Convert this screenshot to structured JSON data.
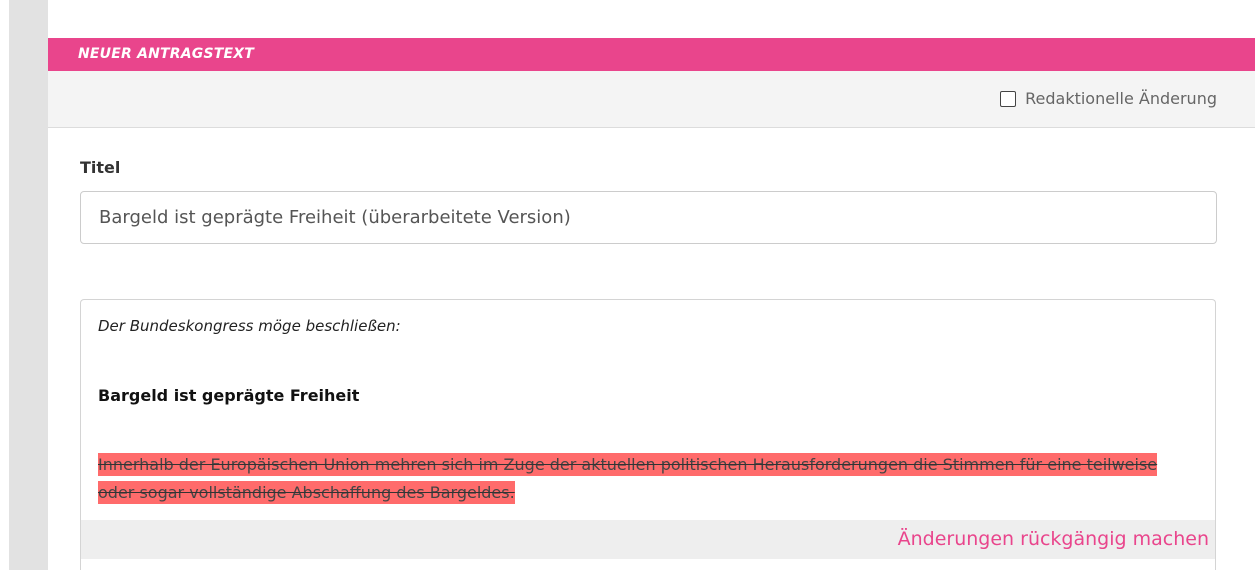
{
  "section": {
    "header": "NEUER ANTRAGSTEXT"
  },
  "options": {
    "redaktionell_label": "Redaktionelle Änderung",
    "redaktionell_checked": false
  },
  "title_field": {
    "label": "Titel",
    "value": "Bargeld ist geprägte Freiheit (überarbeitete Version)"
  },
  "editor": {
    "intro": "Der Bundeskongress möge beschließen:",
    "heading": "Bargeld ist geprägte Freiheit",
    "deleted_text": "Innerhalb der Europäischen Union mehren sich im Zuge der aktuellen politischen Herausforderungen die Stimmen für eine teilweise oder sogar vollständige Abschaffung des Bargeldes.",
    "undo_label": "Änderungen rückgängig machen"
  },
  "colors": {
    "accent": "#e9458c",
    "deleted_highlight": "#ff6b6b",
    "gutter": "#e2e2e2"
  }
}
